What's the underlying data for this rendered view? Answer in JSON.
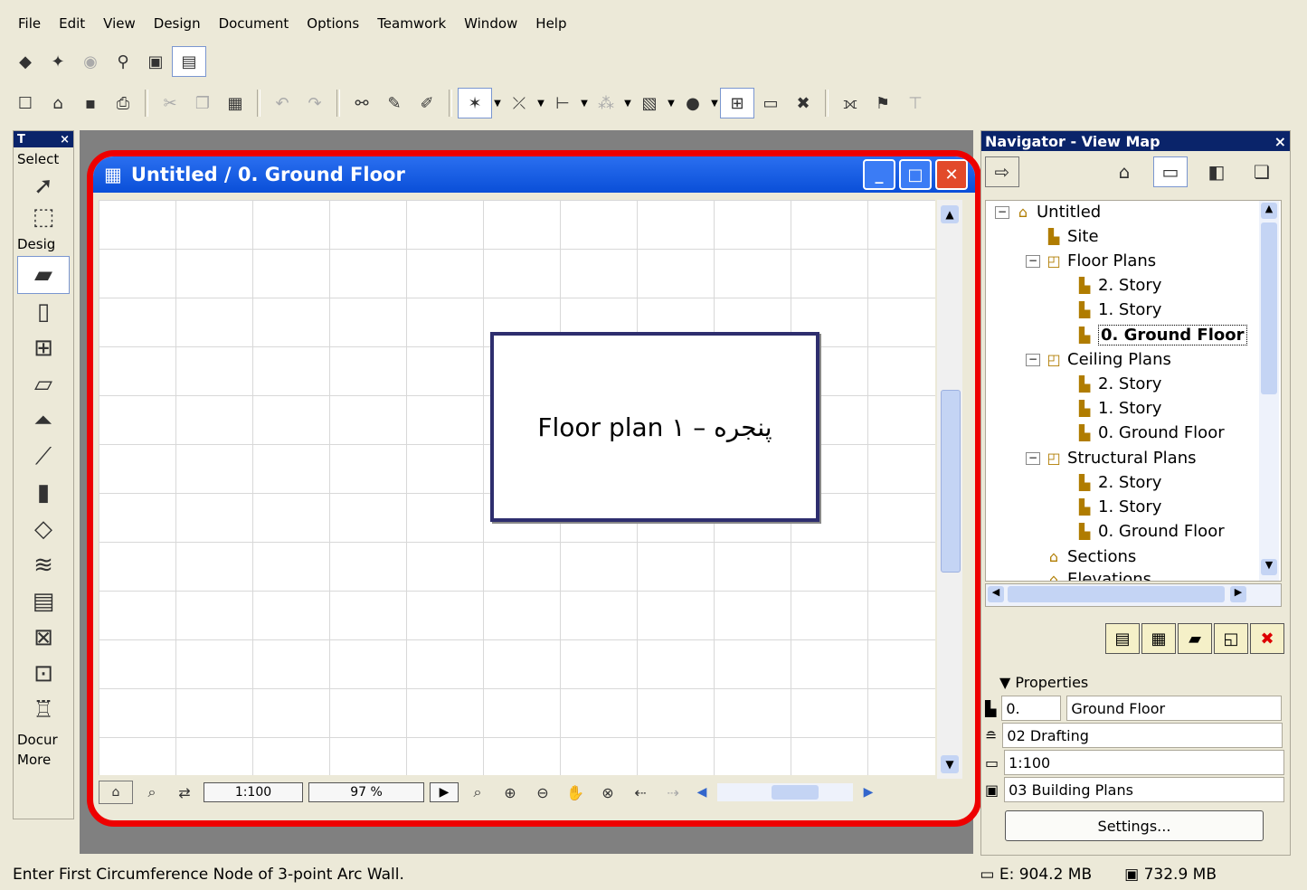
{
  "menu": [
    "File",
    "Edit",
    "View",
    "Design",
    "Document",
    "Options",
    "Teamwork",
    "Window",
    "Help"
  ],
  "toolbox": {
    "title": "T",
    "close": "×",
    "select_label": "Select",
    "design_label": "Desig",
    "document_label": "Docur",
    "more_label": "More"
  },
  "window": {
    "title": "Untitled / 0. Ground Floor",
    "scale": "1:100",
    "zoom": "97 %"
  },
  "callout": {
    "text": "Floor plan پنجره – ١"
  },
  "navigator": {
    "title": "Navigator - View Map",
    "close": "×",
    "tree": {
      "root": "Untitled",
      "site": "Site",
      "floor_plans": "Floor Plans",
      "fp_2": "2. Story",
      "fp_1": "1. Story",
      "fp_0": "0. Ground Floor",
      "ceiling_plans": "Ceiling Plans",
      "cp_2": "2. Story",
      "cp_1": "1. Story",
      "cp_0": "0. Ground Floor",
      "structural_plans": "Structural Plans",
      "sp_2": "2. Story",
      "sp_1": "1. Story",
      "sp_0": "0. Ground Floor",
      "sections": "Sections",
      "elevations": "Elevations"
    },
    "properties": {
      "header": "Properties",
      "story_num": "0.",
      "story_name": "Ground Floor",
      "pen_set": "02 Drafting",
      "scale": "1:100",
      "layer_combo": "03 Building Plans",
      "settings_button": "Settings..."
    }
  },
  "status": {
    "message": "Enter First Circumference Node of 3-point Arc Wall.",
    "disk": "E: 904.2 MB",
    "memory": "732.9 MB"
  }
}
